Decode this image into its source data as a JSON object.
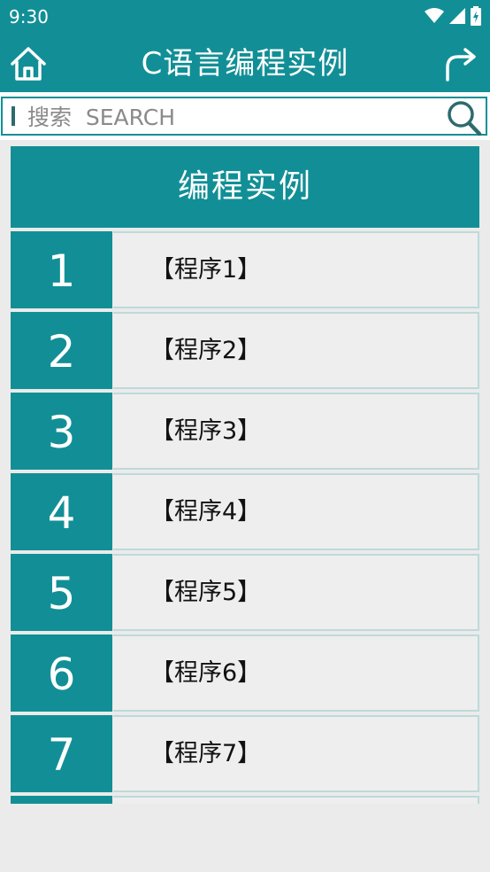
{
  "status_bar": {
    "time": "9:30"
  },
  "header": {
    "title": "C语言编程实例"
  },
  "search": {
    "placeholder": "搜索  SEARCH",
    "value": ""
  },
  "section": {
    "title": "编程实例"
  },
  "list": {
    "items": [
      {
        "number": "1",
        "label": "【程序1】"
      },
      {
        "number": "2",
        "label": "【程序2】"
      },
      {
        "number": "3",
        "label": "【程序3】"
      },
      {
        "number": "4",
        "label": "【程序4】"
      },
      {
        "number": "5",
        "label": "【程序5】"
      },
      {
        "number": "6",
        "label": "【程序6】"
      },
      {
        "number": "7",
        "label": "【程序7】"
      },
      {
        "number": "",
        "label": ""
      }
    ]
  },
  "colors": {
    "primary": "#128f96",
    "background": "#ebebeb",
    "row_bg": "#eeeeee"
  },
  "icons": {
    "home": "home-icon",
    "share": "share-icon",
    "search": "search-icon",
    "wifi": "wifi-icon",
    "signal": "signal-icon",
    "battery": "battery-icon"
  }
}
